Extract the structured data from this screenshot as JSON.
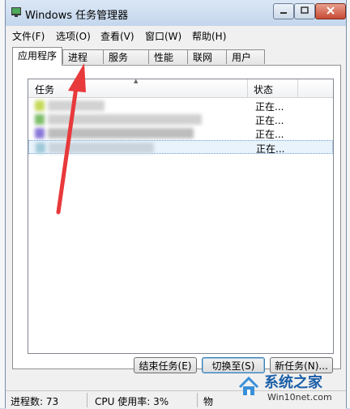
{
  "window": {
    "title": "Windows 任务管理器"
  },
  "menu": [
    "文件(F)",
    "选项(O)",
    "查看(V)",
    "窗口(W)",
    "帮助(H)"
  ],
  "tabs": [
    "应用程序",
    "进程",
    "服务",
    "性能",
    "联网",
    "用户"
  ],
  "active_tab": "应用程序",
  "table": {
    "columns": [
      "任务",
      "状态"
    ],
    "rows": [
      {
        "status": "正在..."
      },
      {
        "status": "正在..."
      },
      {
        "status": "正在..."
      },
      {
        "status": "正在..."
      }
    ]
  },
  "buttons": {
    "end_task": "结束任务(E)",
    "switch_to": "切换至(S)",
    "new_task": "新任务(N)..."
  },
  "statusbar": {
    "processes": "进程数: 73",
    "cpu": "CPU 使用率: 3%",
    "memory_partial": "物"
  },
  "watermark": {
    "brand": "系统之家",
    "site": "Win10net.com"
  },
  "colors": {
    "annotation_arrow": "#e8393b",
    "selection": "#e9f3fc",
    "window_frame": "#c3d6ec"
  }
}
